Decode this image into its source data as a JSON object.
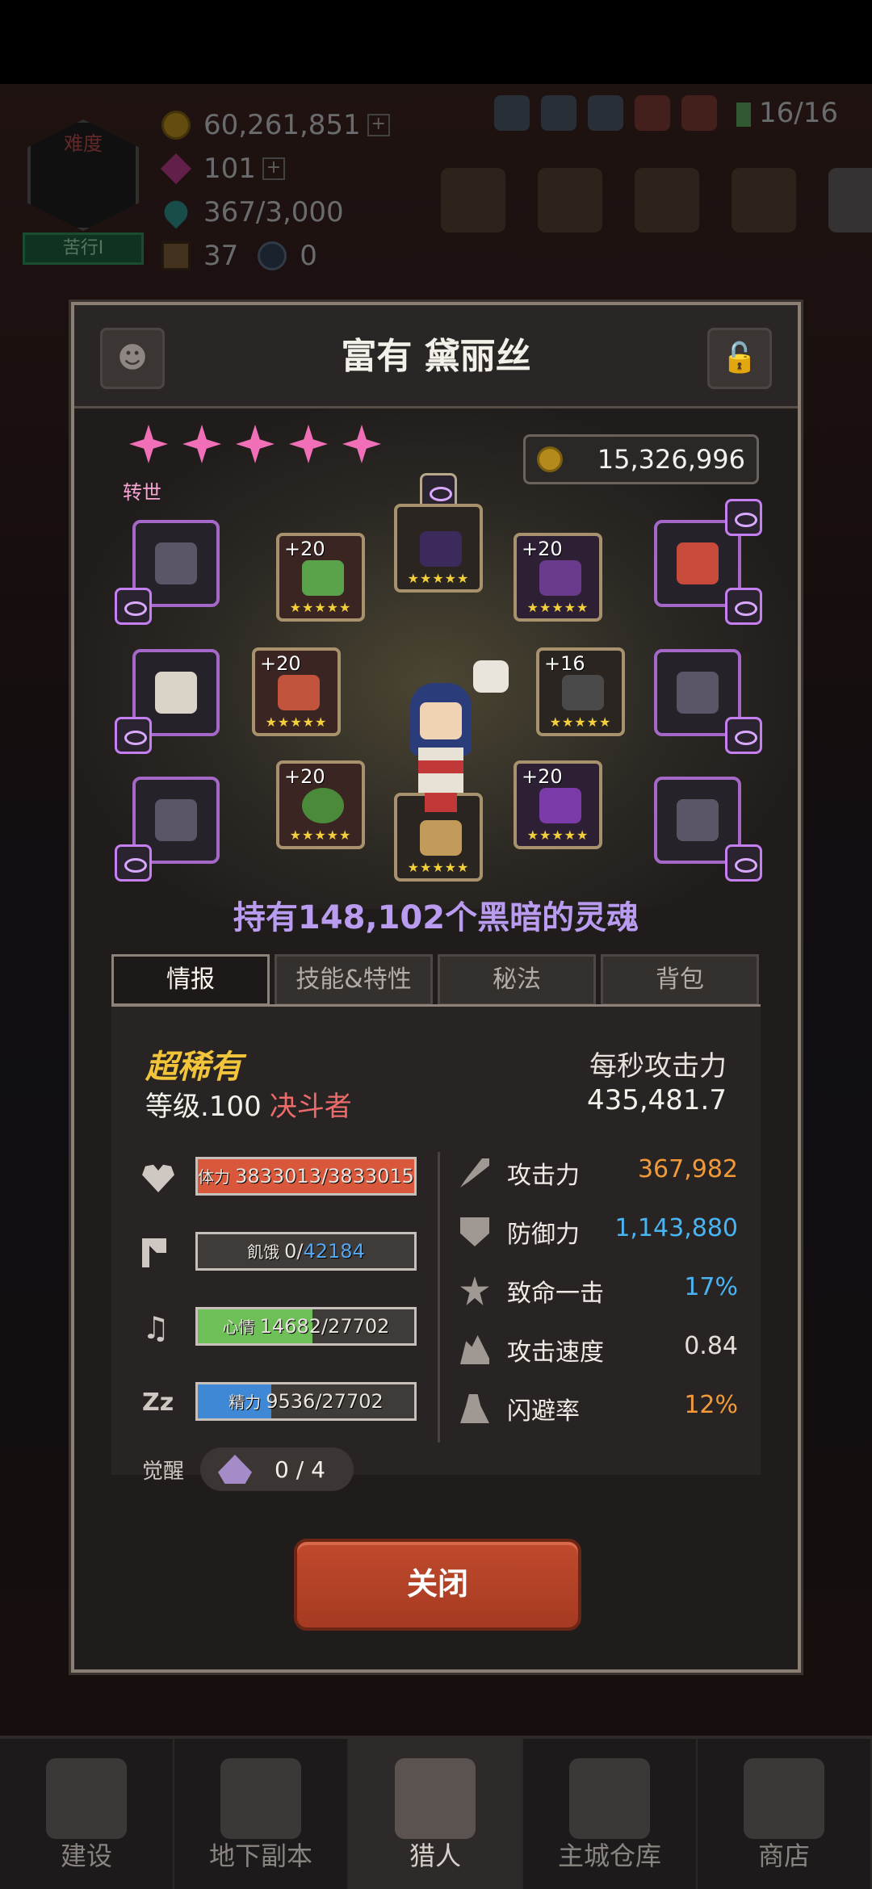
{
  "hud": {
    "gold": "60,261,851",
    "gems": "101",
    "souls_cap": "367/3,000",
    "chests": "37",
    "orbs": "0",
    "population": "16/16",
    "difficulty_title": "难度",
    "difficulty_badge": "苦行I"
  },
  "bottom_nav": [
    {
      "label": "建设",
      "icon": "hammer-icon"
    },
    {
      "label": "地下副本",
      "icon": "dungeon-gate-icon"
    },
    {
      "label": "猎人",
      "icon": "hunter-icon"
    },
    {
      "label": "主城仓库",
      "icon": "storage-chest-icon"
    },
    {
      "label": "商店",
      "icon": "shop-icon"
    }
  ],
  "modal": {
    "title": "富有 黛丽丝",
    "rebirth_label": "转世",
    "gold": "15,326,996",
    "souls_text": "持有148,102个黑暗的灵魂",
    "tabs": [
      {
        "label": "情报",
        "active": true
      },
      {
        "label": "技能&特性",
        "active": false
      },
      {
        "label": "秘法",
        "active": false
      },
      {
        "label": "背包",
        "active": false
      }
    ],
    "equipment": {
      "necklace": {
        "level": "+20",
        "stars": "★★★★★"
      },
      "helmet": {
        "level": "",
        "stars": "★★★★★"
      },
      "armor": {
        "level": "+20",
        "stars": "★★★★★"
      },
      "weapon": {
        "level": "+20",
        "stars": "★★★★★"
      },
      "gloves": {
        "level": "+16",
        "stars": "★★★★★"
      },
      "ring": {
        "level": "+20",
        "stars": "★★★★★"
      },
      "relic": {
        "level": "",
        "stars": "★★★★★"
      },
      "boots": {
        "level": "+20",
        "stars": "★★★★★"
      }
    },
    "info": {
      "rarity": "超稀有",
      "level": "等级.100",
      "class": "决斗者",
      "dps_label": "每秒攻击力",
      "dps_value": "435,481.7",
      "bars": {
        "hp": {
          "label": "体力",
          "value": "3833013/3833015",
          "fraction": 1.0,
          "color": "#d9583c"
        },
        "hunger": {
          "label": "飢饿",
          "current": "0",
          "max": "42184",
          "fraction": 0.0,
          "color": "#3f3b39"
        },
        "mood": {
          "label": "心情",
          "value": "14682/27702",
          "fraction": 0.53,
          "color": "#6fbf59"
        },
        "energy": {
          "label": "精力",
          "value": "9536/27702",
          "fraction": 0.34,
          "color": "#3f88d6"
        }
      },
      "awaken_label": "觉醒",
      "awaken_value": "0 / 4",
      "stats": [
        {
          "label": "攻击力",
          "value": "367,982",
          "color": "orange",
          "icon": "sword-icon"
        },
        {
          "label": "防御力",
          "value": "1,143,880",
          "color": "blue",
          "icon": "shield-icon"
        },
        {
          "label": "致命一击",
          "value": "17%",
          "color": "blue",
          "icon": "crit-icon"
        },
        {
          "label": "攻击速度",
          "value": "0.84",
          "color": "white",
          "icon": "speed-icon"
        },
        {
          "label": "闪避率",
          "value": "12%",
          "color": "orange",
          "icon": "dodge-icon"
        }
      ]
    },
    "close_label": "关闭"
  },
  "colors": {
    "accent_purple": "#a568c8",
    "close_button": "#b3412a",
    "gold_text": "#f2c43a"
  }
}
